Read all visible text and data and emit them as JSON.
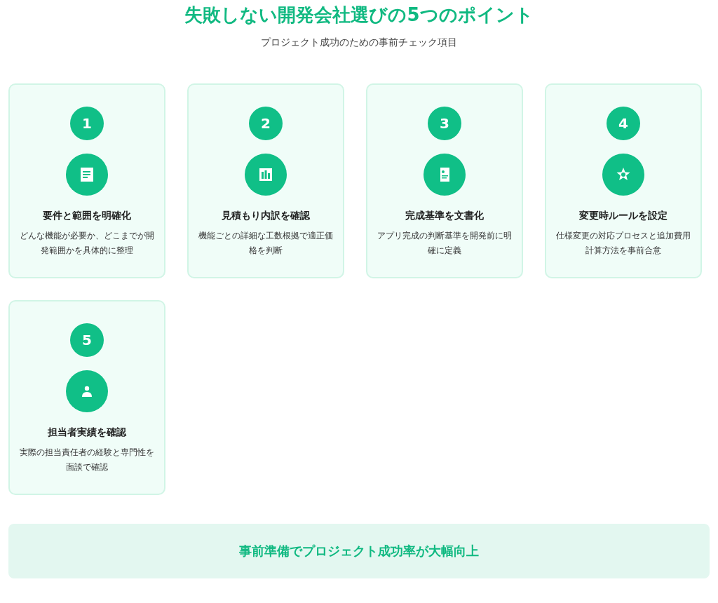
{
  "title": "失敗しない開発会社選びの5つのポイント",
  "subtitle": "プロジェクト成功のための事前チェック項目",
  "points": [
    {
      "number": "1",
      "kind": "document",
      "heading": "要件と範囲を明確化",
      "text": "どんな機能が必要か、どこまでが開発範囲かを具体的に整理"
    },
    {
      "number": "2",
      "kind": "chart",
      "heading": "見積もり内訳を確認",
      "text": "機能ごとの詳細な工数根拠で適正価格を判断"
    },
    {
      "number": "3",
      "kind": "profile",
      "heading": "完成基準を文書化",
      "text": "アプリ完成の判断基準を開発前に明確に定義"
    },
    {
      "number": "4",
      "kind": "star",
      "heading": "変更時ルールを設定",
      "text": "仕様変更の対応プロセスと追加費用計算方法を事前合意"
    },
    {
      "number": "5",
      "kind": "person",
      "heading": "担当者実績を確認",
      "text": "実際の担当責任者の経験と専門性を面談で確認"
    }
  ],
  "banner": "事前準備でプロジェクト成功率が大幅向上"
}
